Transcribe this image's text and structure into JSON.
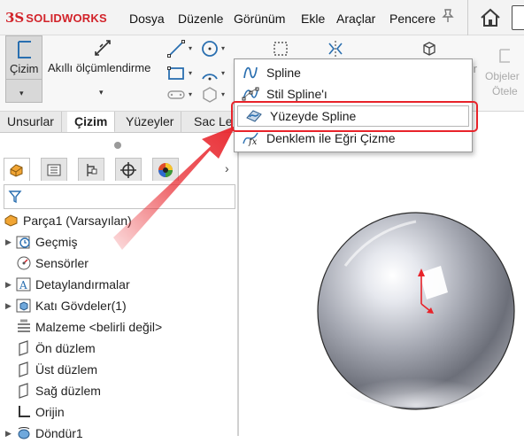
{
  "app": {
    "brand": "SOLIDWORKS",
    "logo_mark": "3S"
  },
  "menubar": {
    "items": [
      "Dosya",
      "Düzenle",
      "Görünüm",
      "Ekle",
      "Araçlar",
      "Pencere"
    ]
  },
  "toolbar": {
    "sketch_label": "Çizim",
    "smart_dim_label": "Akıllı ölçümlendirme",
    "objects_label_1": "Objeler",
    "objects_label_2": "Ötele",
    "partial_label": "ır"
  },
  "tabs": [
    "Unsurlar",
    "Çizim",
    "Yüzeyler",
    "Sac Le"
  ],
  "active_tab": "Çizim",
  "dropdown": {
    "items": [
      {
        "label": "Spline",
        "icon": "spline-icon"
      },
      {
        "label": "Stil Spline'ı",
        "icon": "style-spline-icon"
      },
      {
        "label": "Yüzeyde Spline",
        "icon": "spline-on-surface-icon"
      },
      {
        "label": "Denklem ile Eğri Çizme",
        "icon": "equation-curve-icon"
      }
    ],
    "highlighted": "Yüzeyde Spline"
  },
  "feature_tree": {
    "root": "Parça1  (Varsayılan)",
    "items": [
      {
        "label": "Geçmiş",
        "icon": "history-icon",
        "expandable": true
      },
      {
        "label": "Sensörler",
        "icon": "sensor-icon",
        "expandable": false
      },
      {
        "label": "Detaylandırmalar",
        "icon": "annotation-icon",
        "expandable": true
      },
      {
        "label": "Katı Gövdeler(1)",
        "icon": "solid-bodies-icon",
        "expandable": true
      },
      {
        "label": "Malzeme <belirli değil>",
        "icon": "material-icon",
        "expandable": false
      },
      {
        "label": "Ön düzlem",
        "icon": "plane-icon",
        "expandable": false
      },
      {
        "label": "Üst düzlem",
        "icon": "plane-icon",
        "expandable": false
      },
      {
        "label": "Sağ düzlem",
        "icon": "plane-icon",
        "expandable": false
      },
      {
        "label": "Orijin",
        "icon": "origin-icon",
        "expandable": false
      },
      {
        "label": "Döndür1",
        "icon": "revolve-icon",
        "expandable": true
      }
    ]
  },
  "colors": {
    "accent_red": "#e8232a",
    "brand_red": "#d2232a",
    "selection_blue": "#cfe6f7"
  }
}
